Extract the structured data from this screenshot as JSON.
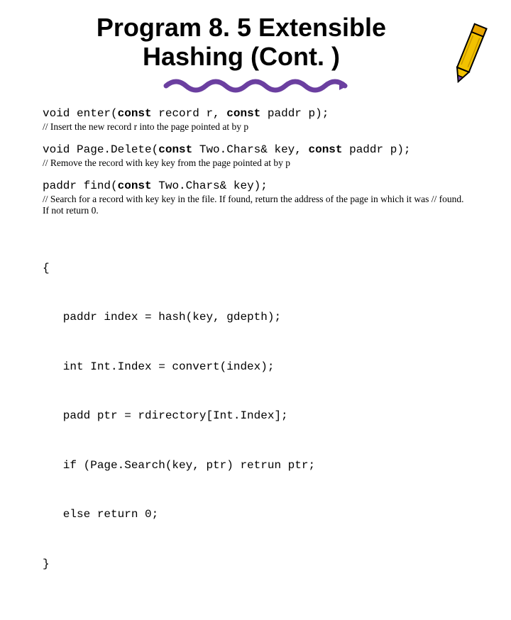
{
  "title": "Program 8. 5 Extensible Hashing (Cont. )",
  "func1": {
    "pre": "void enter(",
    "kw1": "const",
    "mid1": " record r, ",
    "kw2": "const",
    "post": " paddr p);"
  },
  "comment1": "// Insert the new record r into the page pointed at by p",
  "func2": {
    "pre": "void Page.Delete(",
    "kw1": "const",
    "mid1": " Two.Chars& key, ",
    "kw2": "const",
    "post": " paddr p);"
  },
  "comment2": "// Remove the record with key key from the page pointed at by p",
  "func3": {
    "pre": "paddr find(",
    "kw1": "const",
    "post": " Two.Chars& key);"
  },
  "comment3": "// Search for a record with key key in the file. If found, return the address of the page in which it was // found. If not return 0.",
  "code": {
    "l1": "{",
    "l2": "   paddr index = hash(key, gdepth);",
    "l3": "   int Int.Index = convert(index);",
    "l4": "   padd ptr = rdirectory[Int.Index];",
    "l5": "   if (Page.Search(key, ptr) retrun ptr;",
    "l6": "   else return 0;",
    "l7": "}"
  }
}
